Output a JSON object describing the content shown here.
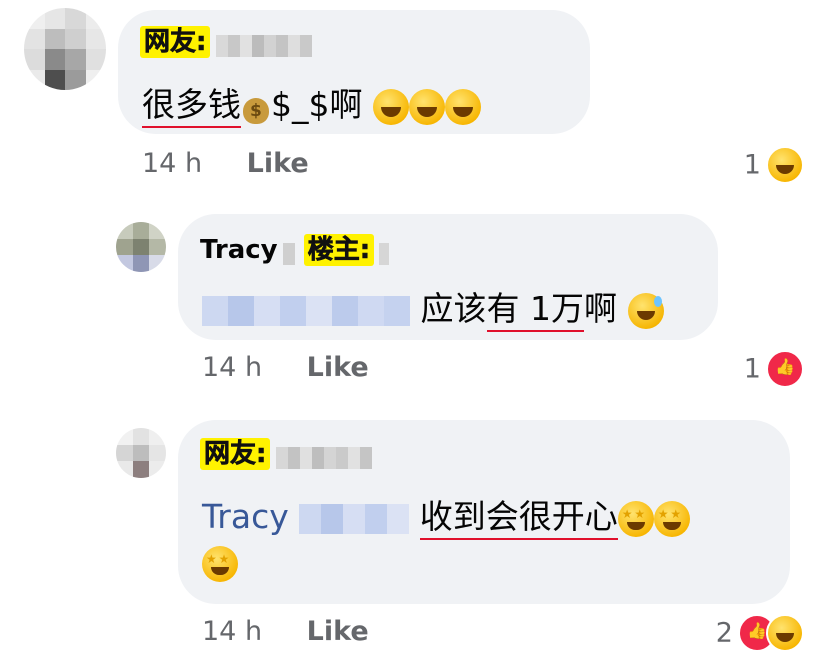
{
  "comments": [
    {
      "tag": "网友:",
      "name_blurred": "",
      "segments": [
        "很多钱",
        "$_$啊"
      ],
      "time": "14 h",
      "like_label": "Like",
      "reaction_count": "1",
      "reactions": [
        "haha"
      ]
    },
    {
      "name": "Tracy",
      "tag": "楼主:",
      "mention_blurred": "",
      "text_before": "应该",
      "text_underlined": "有 1万",
      "text_after": "啊",
      "time": "14 h",
      "like_label": "Like",
      "reaction_count": "1",
      "reactions": [
        "like"
      ]
    },
    {
      "tag": "网友:",
      "mention": "Tracy",
      "text_underlined": "收到会很开心",
      "time": "14 h",
      "like_label": "Like",
      "reaction_count": "2",
      "reactions": [
        "like",
        "haha"
      ]
    }
  ],
  "colors": {
    "bubble": "#f0f2f5",
    "tag_bg": "#fff200",
    "underline": "#e0102c",
    "mention": "#385898",
    "meta": "#65676b"
  }
}
